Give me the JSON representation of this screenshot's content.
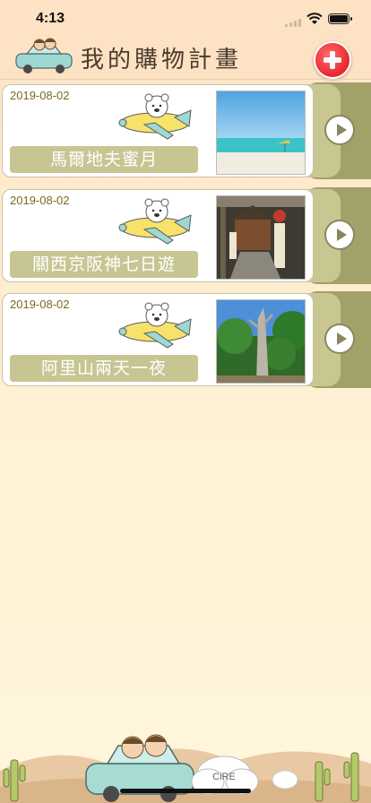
{
  "status_bar": {
    "time": "4:13"
  },
  "header": {
    "title": "我的購物計畫"
  },
  "trips": [
    {
      "date": "2019-08-02",
      "name": "馬爾地夫蜜月"
    },
    {
      "date": "2019-08-02",
      "name": "關西京阪神七日遊"
    },
    {
      "date": "2019-08-02",
      "name": "阿里山兩天一夜"
    }
  ],
  "footer": {
    "cloud_text": "CiRE"
  }
}
